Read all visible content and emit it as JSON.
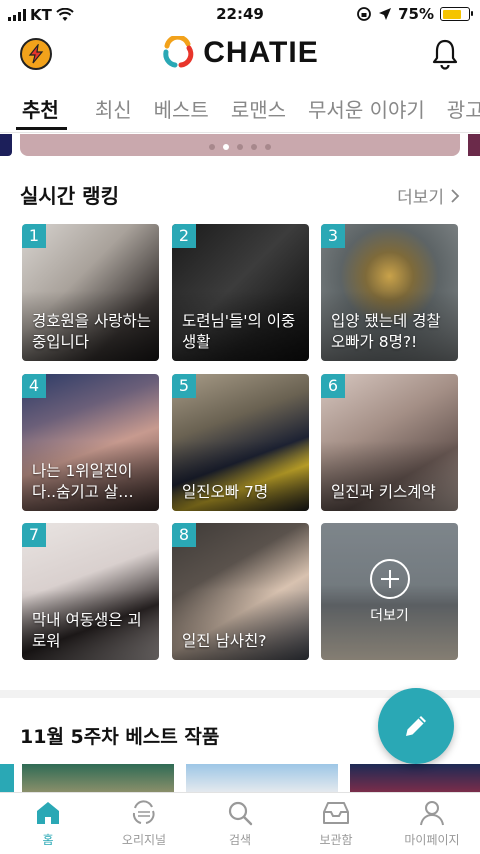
{
  "status_bar": {
    "carrier": "KT",
    "time": "22:49",
    "battery_percent": "75%",
    "battery_level": 0.75,
    "battery_color": "#f5c400"
  },
  "header": {
    "logo_text": "CHATIE",
    "left_icon": "lightning-icon",
    "right_icon": "bell-icon"
  },
  "tabs": [
    {
      "label": "추천",
      "active": true
    },
    {
      "label": "최신",
      "active": false
    },
    {
      "label": "베스트",
      "active": false
    },
    {
      "label": "로맨스",
      "active": false
    },
    {
      "label": "무서운 이야기",
      "active": false
    },
    {
      "label": "광고이",
      "active": false
    }
  ],
  "banner": {
    "page_count": 5,
    "current_page": 2
  },
  "ranking": {
    "title": "실시간 랭킹",
    "more_label": "더보기",
    "items": [
      {
        "rank": "1",
        "title": "경호원을 사랑하는중입니다"
      },
      {
        "rank": "2",
        "title": "도련님'들'의 이중생활"
      },
      {
        "rank": "3",
        "title": "입양 됐는데 경찰오빠가 8명?!"
      },
      {
        "rank": "4",
        "title": "나는 1위일진이다..숨기고 살…"
      },
      {
        "rank": "5",
        "title": "일진오빠 7명"
      },
      {
        "rank": "6",
        "title": "일진과 키스계약"
      },
      {
        "rank": "7",
        "title": "막내 여동생은 괴로워"
      },
      {
        "rank": "8",
        "title": "일진 남사친?"
      }
    ],
    "more_card_label": "더보기"
  },
  "best": {
    "title": "11월 5주차 베스트 작품"
  },
  "bottom_nav": [
    {
      "label": "홈",
      "icon": "home-icon",
      "active": true
    },
    {
      "label": "오리지널",
      "icon": "original-logo-icon",
      "active": false
    },
    {
      "label": "검색",
      "icon": "search-icon",
      "active": false
    },
    {
      "label": "보관함",
      "icon": "inbox-icon",
      "active": false
    },
    {
      "label": "마이페이지",
      "icon": "person-icon",
      "active": false
    }
  ],
  "colors": {
    "accent": "#2aa8b5",
    "lightning_badge": "#f2a21b"
  }
}
